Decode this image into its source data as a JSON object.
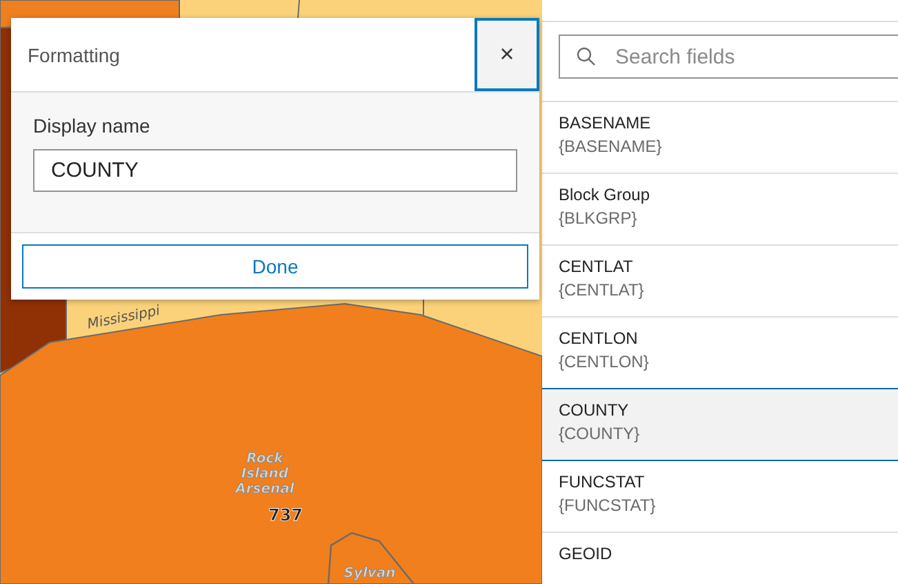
{
  "map": {
    "labels": [
      {
        "kind": "river",
        "text": "Mississippi"
      },
      {
        "kind": "place",
        "text": "Rock Island Arsenal"
      },
      {
        "kind": "value",
        "text": "737"
      },
      {
        "kind": "place",
        "text": "Sylvan"
      }
    ]
  },
  "dialog": {
    "title": "Formatting",
    "close": "×",
    "field_label": "Display name",
    "field_value": "COUNTY",
    "done_button": "Done"
  },
  "fields_panel": {
    "search": {
      "placeholder": "Search fields"
    },
    "fields": [
      {
        "name": "BASENAME",
        "expression": "{BASENAME}",
        "selected": false
      },
      {
        "name": "Block Group",
        "expression": "{BLKGRP}",
        "selected": false
      },
      {
        "name": "CENTLAT",
        "expression": "{CENTLAT}",
        "selected": false
      },
      {
        "name": "CENTLON",
        "expression": "{CENTLON}",
        "selected": false
      },
      {
        "name": "COUNTY",
        "expression": "{COUNTY}",
        "selected": true
      },
      {
        "name": "FUNCSTAT",
        "expression": "{FUNCSTAT}",
        "selected": false
      },
      {
        "name": "GEOID",
        "selected": false
      }
    ]
  }
}
